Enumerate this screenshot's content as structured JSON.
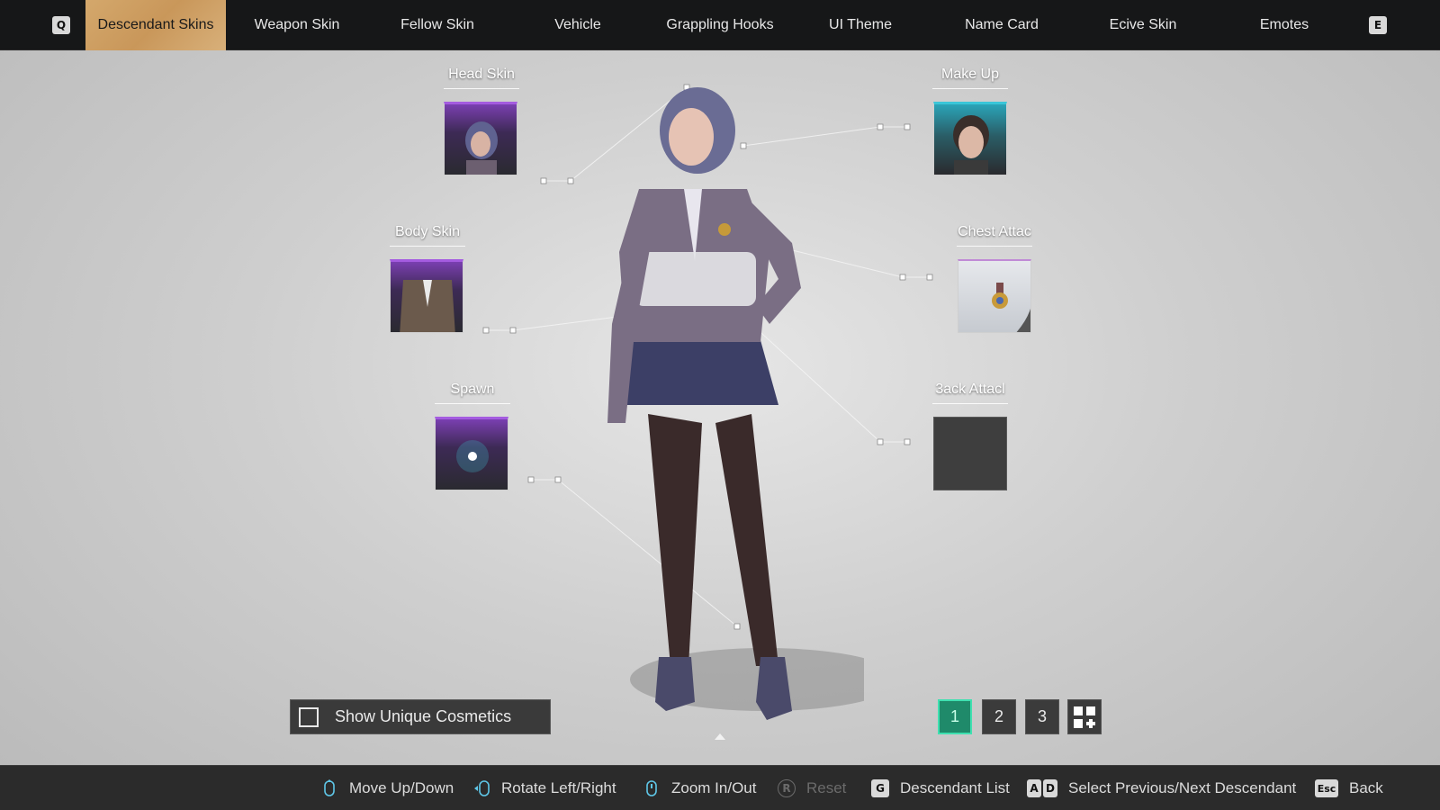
{
  "top_nav": {
    "left_key": "Q",
    "right_key": "E",
    "tabs": [
      {
        "label": "Descendant Skins",
        "active": true
      },
      {
        "label": "Weapon Skin",
        "active": false
      },
      {
        "label": "Fellow Skin",
        "active": false
      },
      {
        "label": "Vehicle",
        "active": false
      },
      {
        "label": "Grappling Hooks",
        "active": false
      },
      {
        "label": "UI Theme",
        "active": false
      },
      {
        "label": "Name Card",
        "active": false
      },
      {
        "label": "Ecive Skin",
        "active": false
      },
      {
        "label": "Emotes",
        "active": false
      }
    ]
  },
  "slots": {
    "head_skin": {
      "label": "Head Skin"
    },
    "body_skin": {
      "label": "Body Skin"
    },
    "spawn": {
      "label": "Spawn"
    },
    "make_up": {
      "label": "Make Up"
    },
    "chest_attach": {
      "label": "Chest Attac"
    },
    "back_attach": {
      "label": "3ack Attacl"
    }
  },
  "unique_cosmetics": {
    "label": "Show Unique Cosmetics",
    "checked": false
  },
  "presets": [
    "1",
    "2",
    "3"
  ],
  "active_preset": "1",
  "bottom_bar": {
    "move": "Move Up/Down",
    "rotate": "Rotate Left/Right",
    "zoom": "Zoom In/Out",
    "reset_key": "R",
    "reset": "Reset",
    "list_key": "G",
    "list": "Descendant List",
    "prev_key": "A",
    "next_key": "D",
    "select": "Select Previous/Next Descendant",
    "back_key": "Esc",
    "back": "Back"
  },
  "colors": {
    "active_tab": "#d4a86c",
    "active_preset": "#1f8a6a",
    "rarity_purple": "#a45be0",
    "rarity_teal": "#3ac6d8"
  }
}
